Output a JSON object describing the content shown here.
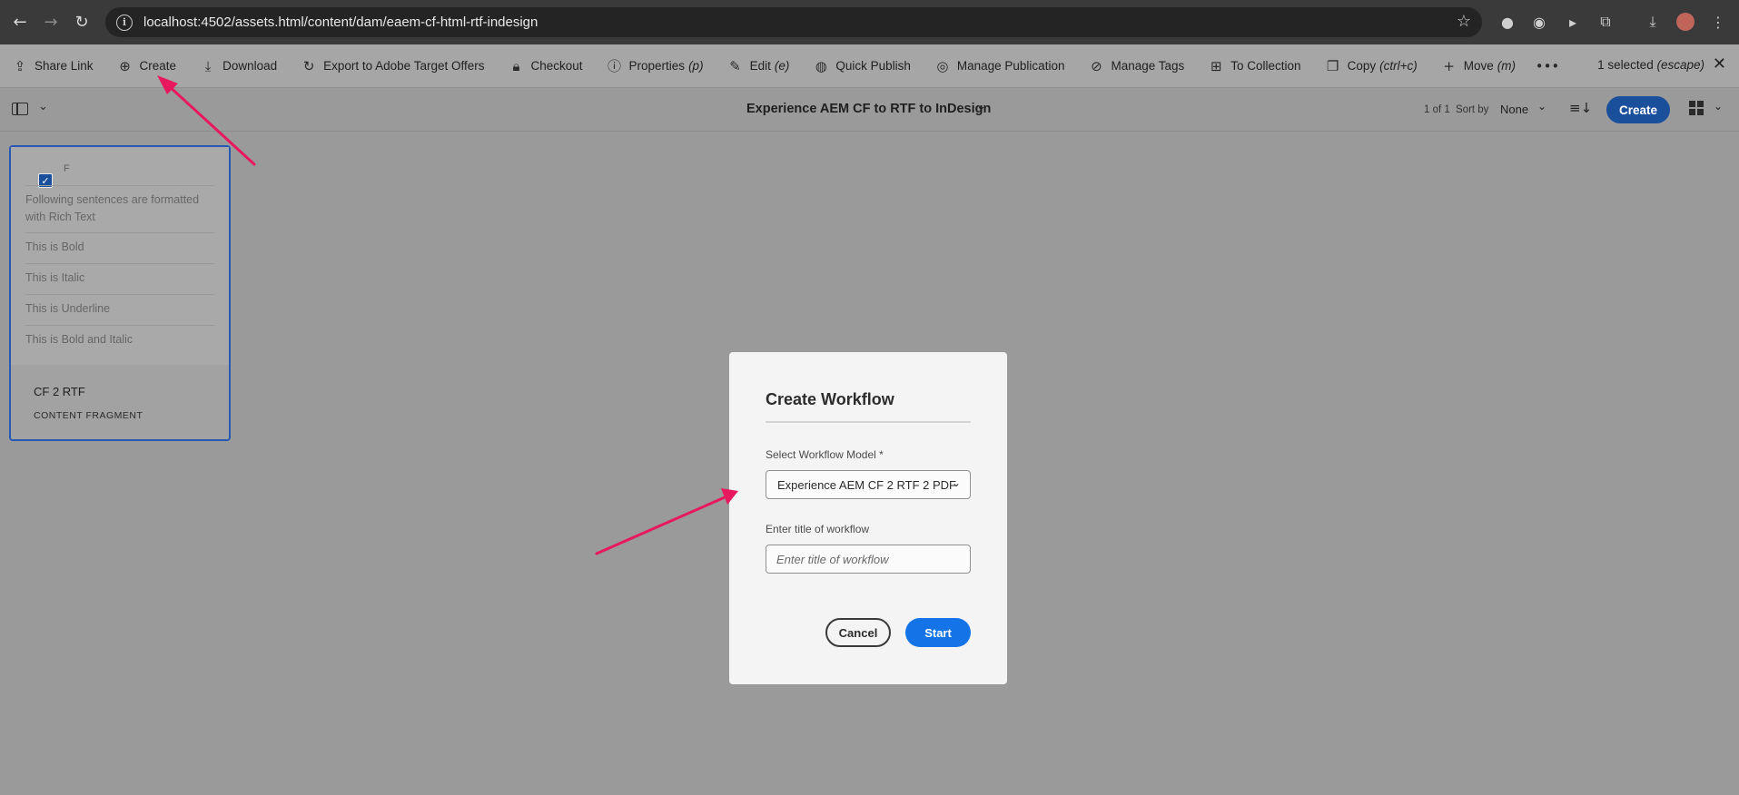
{
  "browser": {
    "url": "localhost:4502/assets.html/content/dam/eaem-cf-html-rtf-indesign"
  },
  "actions": [
    {
      "label": "Share Link",
      "icon": "share-icon",
      "shortcut": ""
    },
    {
      "label": "Create",
      "icon": "plus-circle-icon",
      "shortcut": ""
    },
    {
      "label": "Download",
      "icon": "download-icon",
      "shortcut": ""
    },
    {
      "label": "Export to Adobe Target Offers",
      "icon": "export-icon",
      "shortcut": ""
    },
    {
      "label": "Checkout",
      "icon": "lock-icon",
      "shortcut": ""
    },
    {
      "label": "Properties",
      "icon": "info-icon",
      "shortcut": "(p)"
    },
    {
      "label": "Edit",
      "icon": "pencil-icon",
      "shortcut": "(e)"
    },
    {
      "label": "Quick Publish",
      "icon": "globe-icon",
      "shortcut": ""
    },
    {
      "label": "Manage Publication",
      "icon": "globe-gear-icon",
      "shortcut": ""
    },
    {
      "label": "Manage Tags",
      "icon": "tag-icon",
      "shortcut": ""
    },
    {
      "label": "To Collection",
      "icon": "collection-icon",
      "shortcut": ""
    },
    {
      "label": "Copy",
      "icon": "copy-icon",
      "shortcut": "(ctrl+c)"
    },
    {
      "label": "Move",
      "icon": "move-icon",
      "shortcut": "(m)"
    }
  ],
  "selection": {
    "text": "1 selected",
    "hint": "(escape)"
  },
  "subheader": {
    "folder_title": "Experience AEM CF to RTF to InDesign",
    "count": "1 of 1",
    "sort_label": "Sort by",
    "sort_value": "None",
    "create_label": "Create"
  },
  "card": {
    "preview_title": "F",
    "lines": [
      "Following sentences are formatted with Rich Text",
      "This is Bold",
      "This is Italic",
      "This is Underline",
      "This is Bold and Italic"
    ],
    "name": "CF 2 RTF",
    "type": "CONTENT FRAGMENT"
  },
  "dialog": {
    "title": "Create Workflow",
    "model_label": "Select Workflow Model *",
    "model_value": "Experience AEM CF 2 RTF 2 PDF",
    "title_label": "Enter title of workflow",
    "title_placeholder": "Enter title of workflow",
    "cancel_label": "Cancel",
    "start_label": "Start"
  },
  "colors": {
    "annotation_arrow": "#e8185e",
    "primary_button": "#1473e6",
    "create_button": "#1a4f9c",
    "selection_border": "#2659b3"
  }
}
